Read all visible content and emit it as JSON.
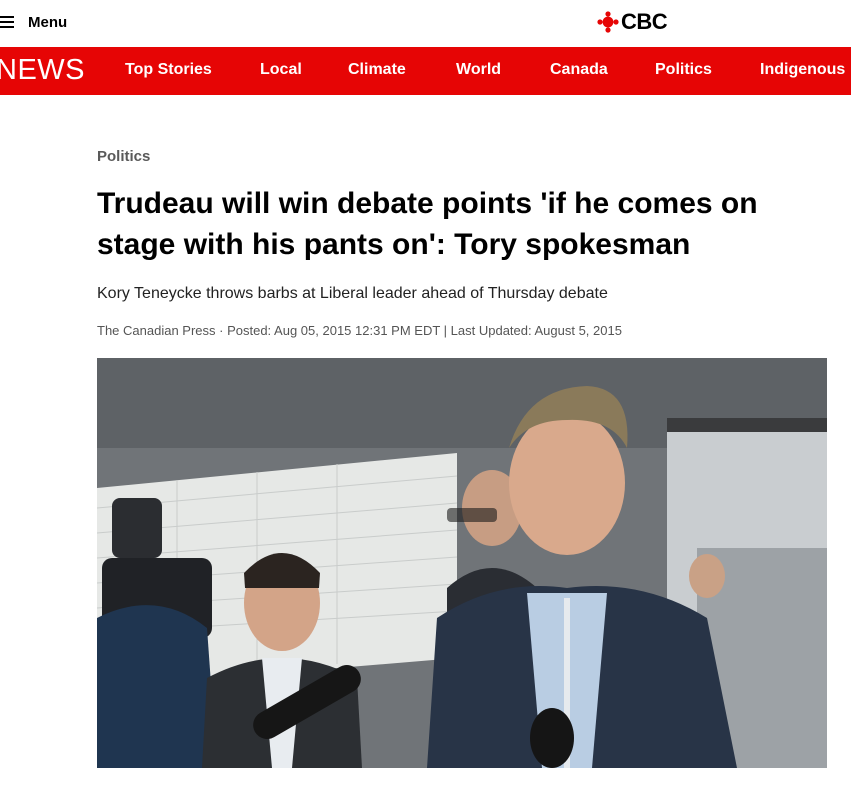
{
  "header": {
    "menu_label": "Menu",
    "logo_text": "CBC"
  },
  "nav": {
    "section_label": "NEWS",
    "items": [
      "Top Stories",
      "Local",
      "Climate",
      "World",
      "Canada",
      "Politics",
      "Indigenous"
    ]
  },
  "article": {
    "category": "Politics",
    "headline": "Trudeau will win debate points 'if he comes on stage with his pants on': Tory spokesman",
    "subhead": "Kory Teneycke throws barbs at Liberal leader ahead of Thursday debate",
    "byline": {
      "source": "The Canadian Press",
      "separator": " · ",
      "posted": "Posted: Aug 05, 2015 12:31 PM EDT",
      "divider": " | ",
      "updated": "Last Updated: August 5, 2015"
    }
  },
  "colors": {
    "brand_red": "#e60505",
    "category_gray": "#5a5a5a"
  },
  "icons": {
    "menu": "hamburger-icon",
    "logo": "cbc-gem-icon"
  }
}
